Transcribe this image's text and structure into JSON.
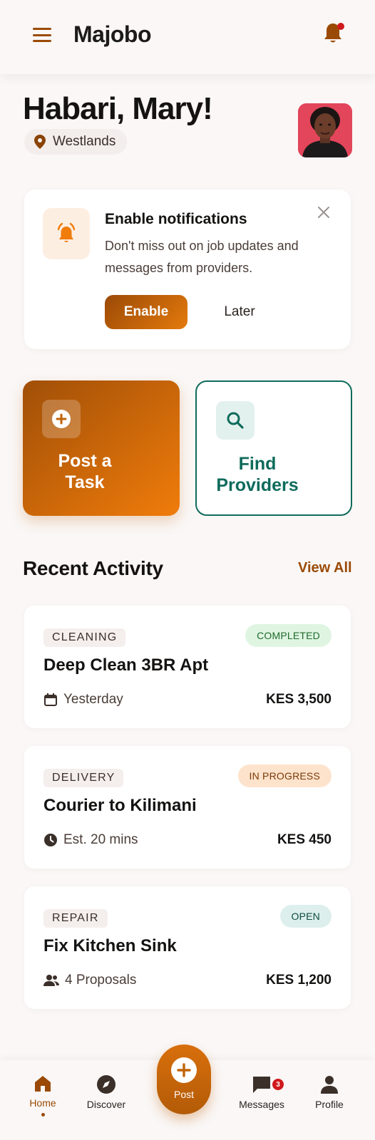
{
  "header": {
    "app_title": "Majobo",
    "menu_icon": "hamburger-menu-icon",
    "bell_icon": "bell-icon"
  },
  "greeting": {
    "title": "Habari, Mary!",
    "location": "Westlands"
  },
  "notification_prompt": {
    "title": "Enable notifications",
    "message": "Don't miss out on job updates and messages from providers.",
    "enable_label": "Enable",
    "later_label": "Later"
  },
  "quick_actions": {
    "post_task": "Post a Task",
    "find_providers": "Find Providers"
  },
  "recent": {
    "title": "Recent Activity",
    "view_all": "View All",
    "items": [
      {
        "category": "CLEANING",
        "status": "COMPLETED",
        "title": "Deep Clean 3BR Apt",
        "meta": "Yesterday",
        "meta_icon": "calendar-icon",
        "price": "KES 3,500"
      },
      {
        "category": "DELIVERY",
        "status": "IN PROGRESS",
        "title": "Courier to Kilimani",
        "meta": "Est. 20 mins",
        "meta_icon": "clock-icon",
        "price": "KES 450"
      },
      {
        "category": "REPAIR",
        "status": "OPEN",
        "title": "Fix Kitchen Sink",
        "meta": "4 Proposals",
        "meta_icon": "people-icon",
        "price": "KES 1,200"
      }
    ]
  },
  "bottom_nav": {
    "home": "Home",
    "discover": "Discover",
    "post": "Post",
    "messages": "Messages",
    "messages_badge": "3",
    "profile": "Profile"
  },
  "colors": {
    "accent": "#9a4a06",
    "accent_bright": "#f07c0a",
    "teal": "#0f6b5c",
    "completed_bg": "#dff5e2",
    "completed_fg": "#1f6b2c",
    "progress_bg": "#fde3cc",
    "progress_fg": "#7a3806",
    "open_bg": "#dcefec",
    "open_fg": "#0f4a42",
    "alert_red": "#d0191c"
  }
}
